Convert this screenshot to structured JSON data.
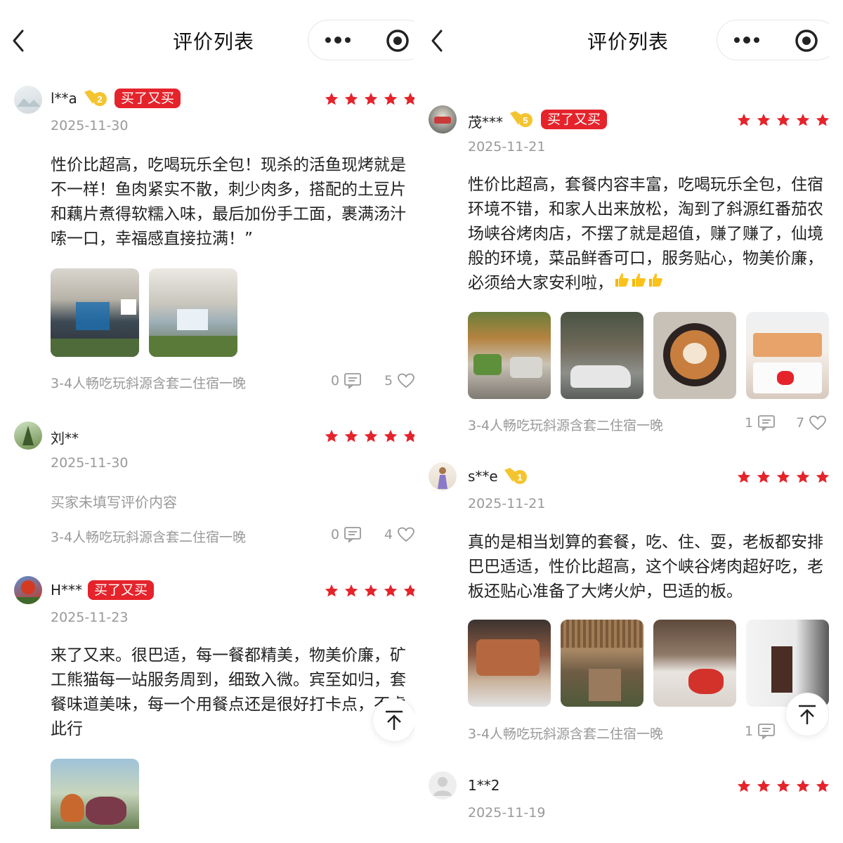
{
  "left": {
    "title": "评价列表",
    "reviews": [
      {
        "username": "l**a",
        "level": "2",
        "badge": "买了又买",
        "date": "2025-11-30",
        "text": "性价比超高，吃喝玩乐全包！现杀的活鱼现烤就是不一样！鱼肉紧实不散，刺少肉多，搭配的土豆片和藕片煮得软糯入味，最后加份手工面，裹满汤汁嗦一口，幸福感直接拉满！”",
        "package": "3-4人畅吃玩斜源含套二住宿一晚",
        "comments": "0",
        "likes": "5"
      },
      {
        "username": "刘**",
        "date": "2025-11-30",
        "text": "买家未填写评价内容",
        "package": "3-4人畅吃玩斜源含套二住宿一晚",
        "comments": "0",
        "likes": "4"
      },
      {
        "username": "H***",
        "badge": "买了又买",
        "date": "2025-11-23",
        "text": "来了又来。很巴适，每一餐都精美，物美价廉，矿工熊猫每一站服务周到，细致入微。宾至如归，套餐味道美味，每一个用餐点还是很好打卡点，不虚此行"
      }
    ]
  },
  "right": {
    "title": "评价列表",
    "reviews": [
      {
        "username": "茂***",
        "level": "5",
        "badge": "买了又买",
        "date": "2025-11-21",
        "text": "性价比超高，套餐内容丰富，吃喝玩乐全包，住宿环境不错，和家人出来放松，淘到了斜源红番茄农场峡谷烤肉店，不摆了就是超值，赚了赚了，仙境般的环境，菜品鲜香可口，服务贴心，物美价廉，必须给大家安利啦，",
        "package": "3-4人畅吃玩斜源含套二住宿一晚",
        "comments": "1",
        "likes": "7"
      },
      {
        "username": "s**e",
        "level": "1",
        "date": "2025-11-21",
        "text": "真的是相当划算的套餐，吃、住、耍，老板都安排巴巴适适，性价比超高，这个峡谷烤肉超好吃，老板还贴心准备了大烤火炉，巴适的板。",
        "package": "3-4人畅吃玩斜源含套二住宿一晚",
        "comments": "1"
      },
      {
        "username": "1**2",
        "date": "2025-11-19"
      }
    ]
  },
  "colors": {
    "accent": "#e5232b",
    "gold": "#f4c430",
    "muted": "#999999"
  },
  "icons": [
    "back-icon",
    "more-dots-icon",
    "target-icon",
    "star-icon",
    "comment-icon",
    "heart-icon",
    "arrow-up-icon",
    "thumbs-up-icon"
  ]
}
